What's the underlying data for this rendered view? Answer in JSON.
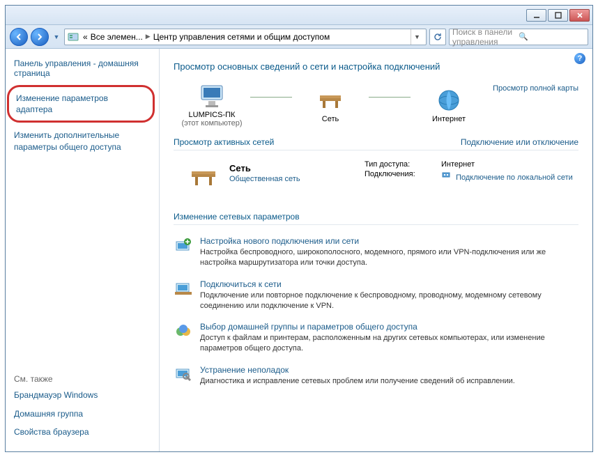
{
  "titlebar": {},
  "nav": {
    "crumb_prefix": "«",
    "crumb1": "Все элемен...",
    "crumb2": "Центр управления сетями и общим доступом",
    "search_placeholder": "Поиск в панели управления"
  },
  "sidebar": {
    "home_link": "Панель управления - домашняя страница",
    "link_adapter": "Изменение параметров адаптера",
    "link_sharing": "Изменить дополнительные параметры общего доступа",
    "see_also_title": "См. также",
    "see_also": {
      "firewall": "Брандмауэр Windows",
      "homegroup": "Домашняя группа",
      "browser": "Свойства браузера"
    }
  },
  "main": {
    "heading": "Просмотр основных сведений о сети и настройка подключений",
    "full_map": "Просмотр полной карты",
    "map": {
      "pc_name": "LUMPICS-ПК",
      "pc_sub": "(этот компьютер)",
      "net": "Сеть",
      "internet": "Интернет"
    },
    "active_title": "Просмотр активных сетей",
    "active_link": "Подключение или отключение",
    "active": {
      "name": "Сеть",
      "type": "Общественная сеть",
      "access_lbl": "Тип доступа:",
      "access_val": "Интернет",
      "conn_lbl": "Подключения:",
      "conn_val": "Подключение по локальной сети"
    },
    "change_title": "Изменение сетевых параметров",
    "tasks": {
      "t1_title": "Настройка нового подключения или сети",
      "t1_desc": "Настройка беспроводного, широкополосного, модемного, прямого или VPN-подключения или же настройка маршрутизатора или точки доступа.",
      "t2_title": "Подключиться к сети",
      "t2_desc": "Подключение или повторное подключение к беспроводному, проводному, модемному сетевому соединению или подключение к VPN.",
      "t3_title": "Выбор домашней группы и параметров общего доступа",
      "t3_desc": "Доступ к файлам и принтерам, расположенным на других сетевых компьютерах, или изменение параметров общего доступа.",
      "t4_title": "Устранение неполадок",
      "t4_desc": "Диагностика и исправление сетевых проблем или получение сведений об исправлении."
    }
  }
}
